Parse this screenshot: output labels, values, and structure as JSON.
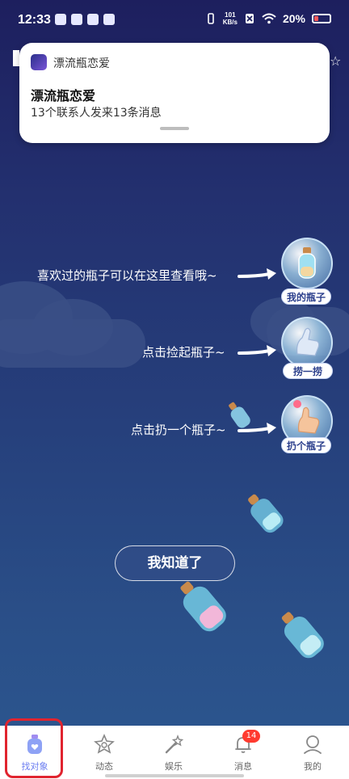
{
  "status_bar": {
    "time": "12:33",
    "net_speed_value": "101",
    "net_speed_unit": "KB/s",
    "battery": "20%"
  },
  "notification": {
    "app_name": "漂流瓶恋爱",
    "title": "漂流瓶恋爱",
    "body": "13个联系人发来13条消息"
  },
  "guides": [
    {
      "text": "喜欢过的瓶子可以在这里查看哦~",
      "button": "我的瓶子"
    },
    {
      "text": "点击捡起瓶子~",
      "button": "捞一捞"
    },
    {
      "text": "点击扔一个瓶子~",
      "button": "扔个瓶子"
    }
  ],
  "confirm_button": "我知道了",
  "tabbar": {
    "tabs": [
      {
        "label": "找对象",
        "icon": "bottle-heart-icon",
        "active": true
      },
      {
        "label": "动态",
        "icon": "star-badge-icon",
        "active": false
      },
      {
        "label": "娱乐",
        "icon": "magic-wand-icon",
        "active": false
      },
      {
        "label": "消息",
        "icon": "bell-icon",
        "active": false,
        "badge": "14"
      },
      {
        "label": "我的",
        "icon": "person-icon",
        "active": false
      }
    ]
  },
  "colors": {
    "accent": "#6a7cf0",
    "highlight": "#e0242f",
    "badge": "#ff3b30"
  }
}
